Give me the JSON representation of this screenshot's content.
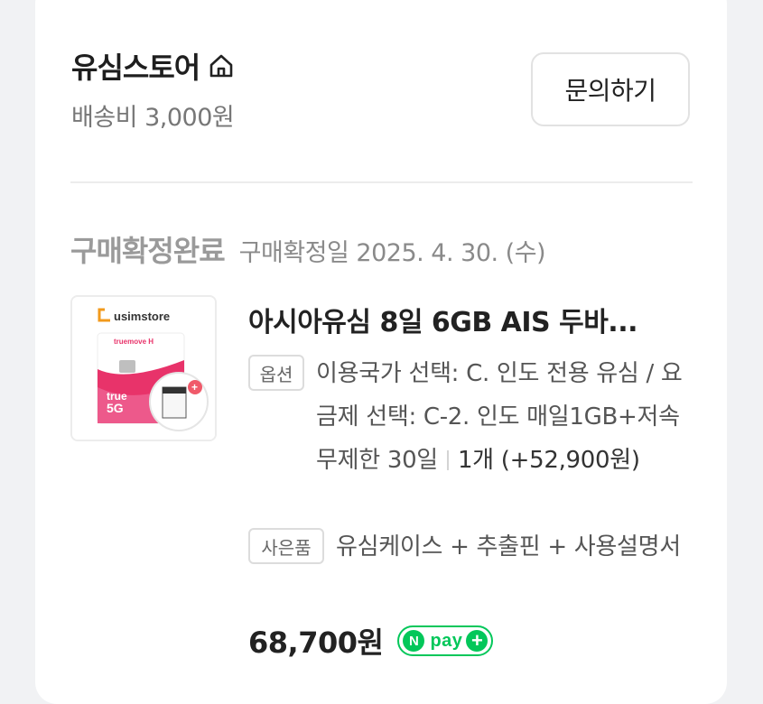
{
  "store": {
    "name": "유심스토어",
    "shipping": "배송비 3,000원",
    "inquiry_label": "문의하기"
  },
  "order": {
    "status": "구매확정완료",
    "confirm_date": "구매확정일 2025. 4. 30. (수)"
  },
  "product": {
    "title": "아시아유심 8일 6GB AIS 두바...",
    "option_badge": "옵션",
    "option_text": "이용국가 선택: C. 인도 전용 유심 / 요금제 선택: C-2. 인도 매일1GB+저속무제한 30일",
    "quantity_text": "1개 (+52,900원)",
    "gift_badge": "사은품",
    "gift_text": "유심케이스 + 추출핀 + 사용설명서",
    "price": "68,700원",
    "thumb_brand": "usimstore",
    "thumb_carrier": "truemove H"
  },
  "npay": {
    "n": "N",
    "label": "pay",
    "plus": "+"
  },
  "colors": {
    "npay_green": "#03c75a",
    "status_gray": "#9a9a9a"
  },
  "icons": {
    "home": "home-icon"
  }
}
